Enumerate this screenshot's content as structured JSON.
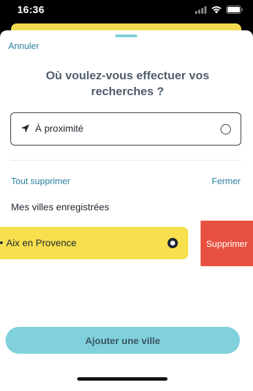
{
  "status": {
    "time": "16:36",
    "icons": [
      "signal-icon",
      "wifi-icon",
      "battery-icon"
    ]
  },
  "sheet": {
    "cancel_label": "Annuler",
    "title": "Où voulez-vous effectuer vos recherches ?",
    "location_option": {
      "label": "À proximité",
      "icon": "location-arrow-icon",
      "selected": false
    },
    "delete_all_label": "Tout supprimer",
    "close_label": "Fermer",
    "saved_cities_title": "Mes villes enregistrées",
    "saved_cities": [
      {
        "label": "Aix en Provence",
        "selected": true,
        "swipe_action_label": "Supprimer"
      }
    ],
    "add_city_label": "Ajouter une ville"
  },
  "colors": {
    "accent_link": "#2a7f9e",
    "city_highlight": "#f7df4d",
    "delete_red": "#e8503f",
    "primary_button": "#80d1dc",
    "grabber": "#7fcfdc"
  }
}
